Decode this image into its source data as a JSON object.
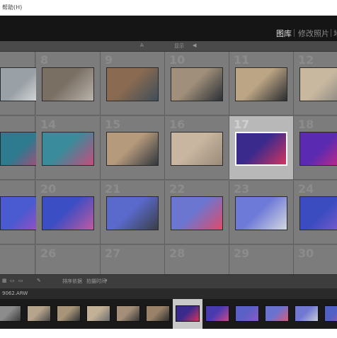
{
  "window": {
    "title": "帮助(H)"
  },
  "modules": {
    "library": "图库",
    "develop": "修改照片",
    "more": "地"
  },
  "filter_bar": {
    "sort": "A",
    "view": "显示"
  },
  "toolbar": {
    "sort_label": "排序依据",
    "sort_value": "拍摄时间"
  },
  "filmstrip": {
    "filename": "9062.ARW"
  },
  "grid": {
    "rows": [
      {
        "cells": [
          {
            "num": "",
            "colors": [
              "#9aa1a6",
              "#f0f0f0"
            ],
            "selected": false
          },
          {
            "num": "8",
            "colors": [
              "#7a6f63",
              "#b9b4ad"
            ],
            "selected": false
          },
          {
            "num": "9",
            "colors": [
              "#8a6a50",
              "#3f4e5a"
            ],
            "selected": false
          },
          {
            "num": "10",
            "colors": [
              "#a08f7a",
              "#2b3036"
            ],
            "selected": false
          },
          {
            "num": "11",
            "colors": [
              "#bca585",
              "#2a2d30"
            ],
            "selected": false
          },
          {
            "num": "12",
            "colors": [
              "#c9b8a0",
              "#7b7b7b"
            ],
            "selected": false
          }
        ]
      },
      {
        "cells": [
          {
            "num": "",
            "colors": [
              "#2e7a8f",
              "#d63a72"
            ],
            "selected": false
          },
          {
            "num": "14",
            "colors": [
              "#3a8b9b",
              "#c44c7c"
            ],
            "selected": false
          },
          {
            "num": "15",
            "colors": [
              "#b69a7c",
              "#32373d"
            ],
            "selected": false
          },
          {
            "num": "16",
            "colors": [
              "#c8b6a0",
              "#9a8a78"
            ],
            "selected": false
          },
          {
            "num": "17",
            "colors": [
              "#3a2a8c",
              "#d2345e"
            ],
            "selected": true
          },
          {
            "num": "18",
            "colors": [
              "#5a2ab0",
              "#e02a7a"
            ],
            "selected": false
          }
        ]
      },
      {
        "cells": [
          {
            "num": "",
            "colors": [
              "#4a5ad0",
              "#b84ac0"
            ],
            "selected": false
          },
          {
            "num": "20",
            "colors": [
              "#3b4ec4",
              "#c05aa0"
            ],
            "selected": false
          },
          {
            "num": "21",
            "colors": [
              "#5a6acc",
              "#3a3f48"
            ],
            "selected": false
          },
          {
            "num": "22",
            "colors": [
              "#6a76d0",
              "#e04a6a"
            ],
            "selected": false
          },
          {
            "num": "23",
            "colors": [
              "#6e7ad8",
              "#d4d8e0"
            ],
            "selected": false
          },
          {
            "num": "24",
            "colors": [
              "#3a4cc0",
              "#8a60d0"
            ],
            "selected": false
          }
        ]
      },
      {
        "cells": [
          {
            "num": "",
            "colors": [
              "#6f6f6f",
              "#6f6f6f"
            ],
            "selected": false
          },
          {
            "num": "26",
            "colors": [
              "#6f6f6f",
              "#6f6f6f"
            ],
            "selected": false
          },
          {
            "num": "27",
            "colors": [
              "#6f6f6f",
              "#6f6f6f"
            ],
            "selected": false
          },
          {
            "num": "28",
            "colors": [
              "#6f6f6f",
              "#6f6f6f"
            ],
            "selected": false
          },
          {
            "num": "29",
            "colors": [
              "#6f6f6f",
              "#6f6f6f"
            ],
            "selected": false
          },
          {
            "num": "30",
            "colors": [
              "#6f6f6f",
              "#6f6f6f"
            ],
            "selected": false
          }
        ]
      }
    ]
  },
  "film": [
    {
      "colors": [
        "#8c8c8c",
        "#3a3a3a"
      ],
      "selected": false
    },
    {
      "colors": [
        "#b6a48c",
        "#4a4a4a"
      ],
      "selected": false
    },
    {
      "colors": [
        "#a89478",
        "#2f3235"
      ],
      "selected": false
    },
    {
      "colors": [
        "#c2b196",
        "#6c6c6c"
      ],
      "selected": false
    },
    {
      "colors": [
        "#a58f78",
        "#353535"
      ],
      "selected": false
    },
    {
      "colors": [
        "#9a8268",
        "#2d2d2d"
      ],
      "selected": false
    },
    {
      "colors": [
        "#3a2a8c",
        "#d2345e"
      ],
      "selected": true
    },
    {
      "colors": [
        "#4a3ab0",
        "#c64a8a"
      ],
      "selected": false
    },
    {
      "colors": [
        "#5a60c8",
        "#8a5ac0"
      ],
      "selected": false
    },
    {
      "colors": [
        "#6a72d0",
        "#d85a7a"
      ],
      "selected": false
    },
    {
      "colors": [
        "#7078d2",
        "#c8ccd6"
      ],
      "selected": false
    },
    {
      "colors": [
        "#5060c4",
        "#b85aa0"
      ],
      "selected": false
    }
  ]
}
